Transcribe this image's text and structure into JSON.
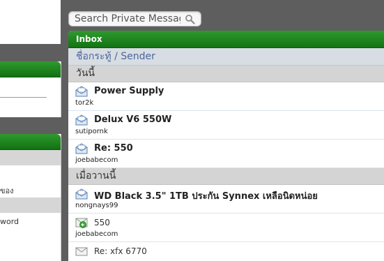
{
  "search": {
    "placeholder": "Search Private Messages"
  },
  "left": {
    "text1": "ของ",
    "text2": "word"
  },
  "panel": {
    "title": "Inbox",
    "columns": {
      "subject": "ชื่อกระทู้",
      "separator": "/",
      "sender": "Sender"
    }
  },
  "groups": [
    {
      "label": "วันนี้",
      "messages": [
        {
          "title": "Power Supply",
          "sender": "tor2k",
          "icon": "envelope-unread-icon"
        },
        {
          "title": "Delux V6 550W",
          "sender": "sutipornk",
          "icon": "envelope-unread-icon"
        },
        {
          "title": "Re: 550",
          "sender": "joebabecom",
          "icon": "envelope-unread-icon"
        }
      ]
    },
    {
      "label": "เมื่อวานนี้",
      "messages": [
        {
          "title": "WD Black 3.5\" 1TB ประกัน Synnex เหลือนิดหน่อย",
          "sender": "nongnays99",
          "icon": "envelope-unread-icon"
        },
        {
          "title": "550",
          "sender": "joebabecom",
          "icon": "envelope-replied-icon"
        },
        {
          "title": "Re: xfx 6770",
          "sender": "",
          "icon": "envelope-read-icon"
        }
      ]
    }
  ]
}
